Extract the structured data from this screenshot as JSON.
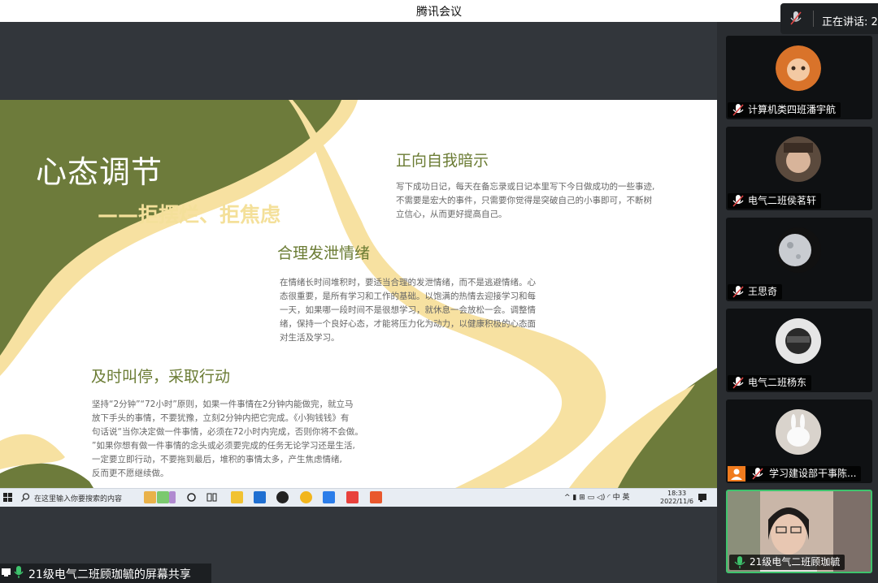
{
  "window": {
    "title": "腾讯会议"
  },
  "speaking": {
    "label": "正在讲话: 2"
  },
  "slide": {
    "title": "心态调节",
    "subtitle": "——拒摆烂、拒焦虑",
    "sections": [
      {
        "heading": "正向自我暗示",
        "lines": [
          "写下成功日记，每天在备忘录或日记本里写下今日做成功的一些事迹,",
          "不需要是宏大的事件，只需要你觉得是突破自己的小事即可，不断树",
          "立信心，从而更好提高自己。"
        ]
      },
      {
        "heading": "合理发泄情绪",
        "lines": [
          "在情绪长时间堆积时，要适当合理的发泄情绪，而不是逃避情绪。心",
          "态很重要，是所有学习和工作的基础。以饱满的热情去迎接学习和每",
          "一天，如果哪一段时间不是很想学习，就休息一会放松一会。调整情",
          "绪，保持一个良好心态，才能将压力化为动力，以健康积极的心态面",
          "对生活及学习。"
        ]
      },
      {
        "heading": "及时叫停，采取行动",
        "lines": [
          "坚持“2分钟”“72小时”原则，如果一件事情在2分钟内能做完，就立马",
          "放下手头的事情，不要犹豫，立刻2分钟内把它完成。《小狗钱钱》有",
          "句话说“当你决定做一件事情，必须在72小时内完成，否则你将不会做。",
          "”如果你想有做一件事情的念头或必须要完成的任务无论学习还是生活,",
          "一定要立即行动，不要拖到最后，堆积的事情太多，产生焦虑情绪,",
          "反而更不愿继续做。"
        ]
      }
    ],
    "colors": {
      "green": "#6d7b3b",
      "cream": "#f7e1a1"
    }
  },
  "taskbar": {
    "search_placeholder": "在这里输入你要搜索的内容",
    "tray_text": "^ ▮ ⊞ ▭ ◁) ◜ 中 英",
    "tray_chars": [
      "英"
    ],
    "time": "18:33",
    "date": "2022/11/6"
  },
  "share": {
    "label": "21级电气二班顾珈毓的屏幕共享"
  },
  "participants": [
    {
      "name": "计算机类四班潘宇航",
      "mic": "muted"
    },
    {
      "name": "电气二班侯茗轩",
      "mic": "muted"
    },
    {
      "name": "王思奇",
      "mic": "muted"
    },
    {
      "name": "电气二班杨东",
      "mic": "muted"
    },
    {
      "name": "学习建设部干事陈...",
      "mic": "muted"
    },
    {
      "name": "21级电气二班顾珈毓",
      "mic": "on"
    }
  ]
}
